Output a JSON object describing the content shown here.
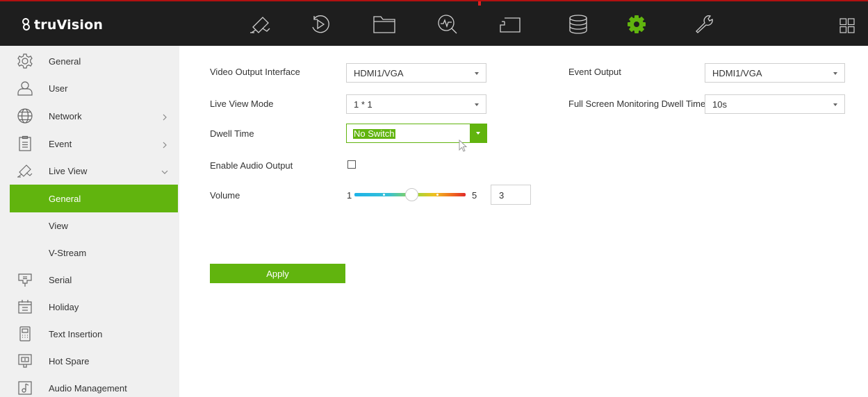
{
  "brand": {
    "name": "truVision"
  },
  "colors": {
    "accent": "#61b40e",
    "topbar_bg": "#1e1e1e",
    "sidebar_bg": "#f0f0f0",
    "top_border": "#b01010"
  },
  "topnav": [
    {
      "id": "live-view",
      "icon": "camera-icon",
      "active": false
    },
    {
      "id": "playback",
      "icon": "playback-icon",
      "active": false
    },
    {
      "id": "files",
      "icon": "folder-icon",
      "active": false
    },
    {
      "id": "search",
      "icon": "search-pulse-icon",
      "active": false
    },
    {
      "id": "ptz",
      "icon": "screen-icon",
      "active": false
    },
    {
      "id": "storage",
      "icon": "database-icon",
      "active": false
    },
    {
      "id": "configuration",
      "icon": "gear-icon",
      "active": true
    },
    {
      "id": "maintenance",
      "icon": "wrench-icon",
      "active": false
    }
  ],
  "layout_icon": "grid-icon",
  "sidebar": {
    "items": [
      {
        "label": "General",
        "icon": "gear-outline-icon"
      },
      {
        "label": "User",
        "icon": "user-icon"
      },
      {
        "label": "Network",
        "icon": "globe-icon",
        "arrow": ">"
      },
      {
        "label": "Event",
        "icon": "clipboard-icon",
        "arrow": ">"
      },
      {
        "label": "Live View",
        "icon": "camera-icon",
        "arrow": "v",
        "expanded": true
      },
      {
        "label": "General",
        "sub": true,
        "active": true
      },
      {
        "label": "View",
        "sub": true
      },
      {
        "label": "V-Stream",
        "sub": true
      },
      {
        "label": "Serial",
        "icon": "serial-icon"
      },
      {
        "label": "Holiday",
        "icon": "calendar-icon"
      },
      {
        "label": "Text Insertion",
        "icon": "pos-terminal-icon"
      },
      {
        "label": "Hot Spare",
        "icon": "hot-spare-icon"
      },
      {
        "label": "Audio Management",
        "icon": "audio-file-icon"
      }
    ]
  },
  "form": {
    "video_output_interface": {
      "label": "Video Output Interface",
      "value": "HDMI1/VGA"
    },
    "live_view_mode": {
      "label": "Live View Mode",
      "value": "1 * 1"
    },
    "dwell_time": {
      "label": "Dwell Time",
      "value": "No Switch"
    },
    "enable_audio_output": {
      "label": "Enable Audio Output",
      "checked": false
    },
    "volume": {
      "label": "Volume",
      "min": "1",
      "max": "5",
      "value": "3",
      "level_fraction": 0.5
    },
    "event_output": {
      "label": "Event Output",
      "value": "HDMI1/VGA"
    },
    "full_screen_dwell": {
      "label": "Full Screen Monitoring Dwell Time",
      "value": "10s"
    },
    "apply": "Apply"
  }
}
